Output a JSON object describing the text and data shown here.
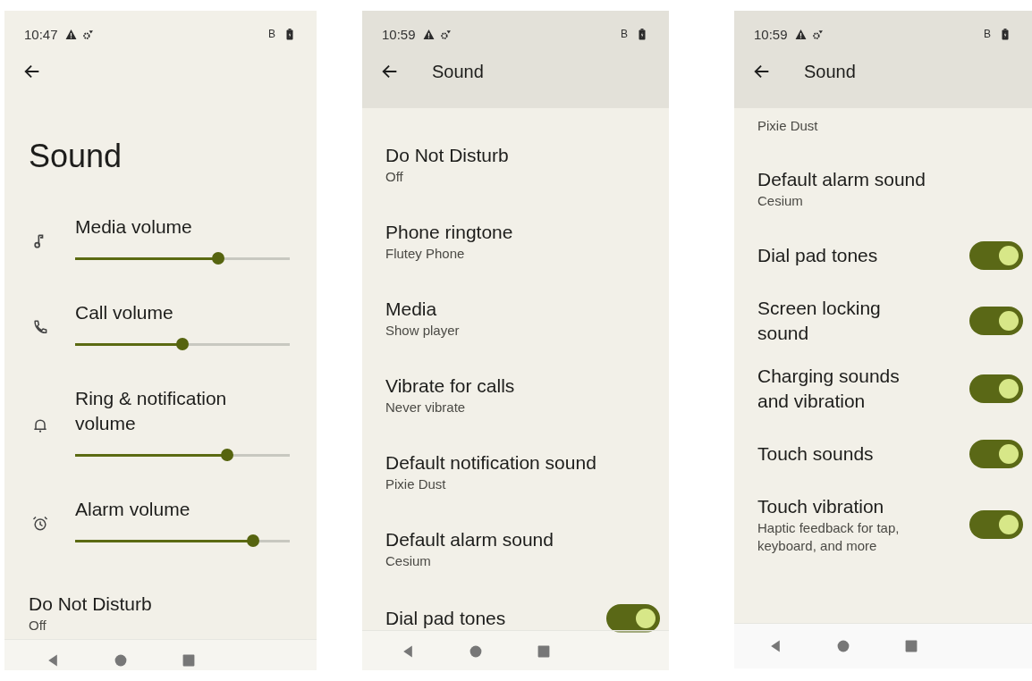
{
  "screens": [
    {
      "status": {
        "time": "10:47",
        "letter": "B"
      },
      "kind": "large-title",
      "title": "Sound",
      "items": [
        {
          "kind": "slider",
          "label": "Media volume",
          "level": 0.665
        },
        {
          "kind": "slider",
          "label": "Call volume",
          "level": 0.5
        },
        {
          "kind": "slider",
          "label": "Ring & notification volume",
          "level": 0.71
        },
        {
          "kind": "slider",
          "label": "Alarm volume",
          "level": 0.83
        },
        {
          "kind": "text",
          "label": "Do Not Disturb",
          "summary": "Off"
        }
      ]
    },
    {
      "status": {
        "time": "10:59",
        "letter": "B"
      },
      "kind": "app-bar",
      "title": "Sound",
      "items": [
        {
          "kind": "text",
          "label": "Do Not Disturb",
          "summary": "Off"
        },
        {
          "kind": "text",
          "label": "Phone ringtone",
          "summary": "Flutey Phone"
        },
        {
          "kind": "text",
          "label": "Media",
          "summary": "Show player"
        },
        {
          "kind": "text",
          "label": "Vibrate for calls",
          "summary": "Never vibrate"
        },
        {
          "kind": "text",
          "label": "Default notification sound",
          "summary": "Pixie Dust"
        },
        {
          "kind": "text",
          "label": "Default alarm sound",
          "summary": "Cesium"
        },
        {
          "kind": "toggle",
          "label": "Dial pad tones",
          "on": true
        }
      ]
    },
    {
      "status": {
        "time": "10:59",
        "letter": "B"
      },
      "kind": "app-bar",
      "title": "Sound",
      "items": [
        {
          "kind": "text",
          "summary": "Pixie Dust"
        },
        {
          "kind": "text",
          "label": "Default alarm sound",
          "summary": "Cesium"
        },
        {
          "kind": "toggle",
          "label": "Dial pad tones",
          "on": true
        },
        {
          "kind": "toggle",
          "label": "Screen locking sound",
          "on": true
        },
        {
          "kind": "toggle",
          "label": "Charging sounds and vibration",
          "on": true
        },
        {
          "kind": "toggle",
          "label": "Touch sounds",
          "on": true
        },
        {
          "kind": "toggle",
          "label": "Touch vibration",
          "summary": "Haptic feedback for tap, keyboard, and more",
          "on": true
        }
      ]
    }
  ]
}
